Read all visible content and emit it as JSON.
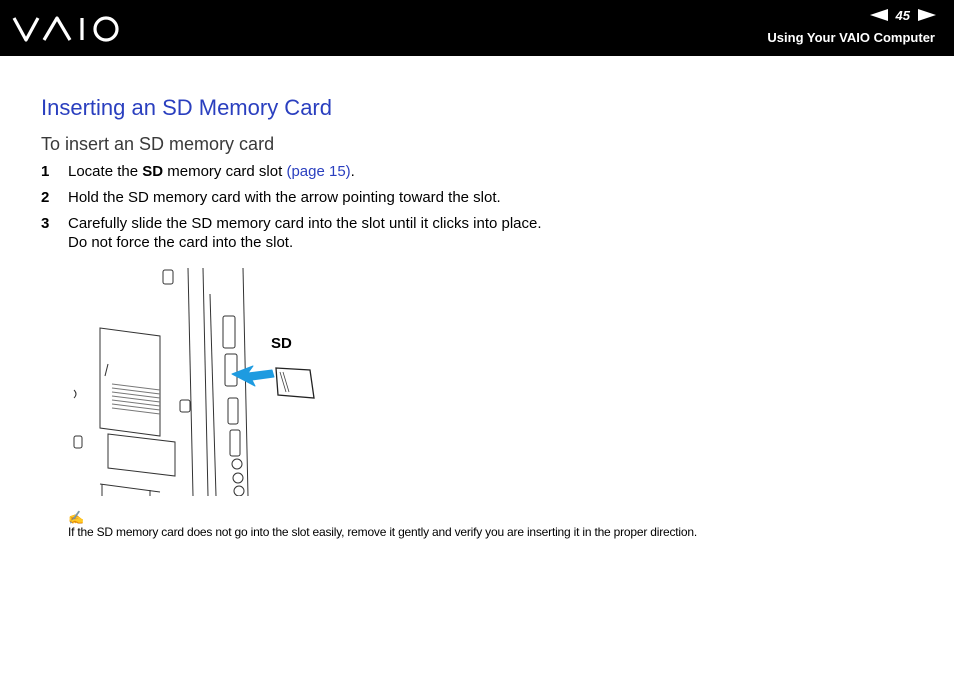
{
  "header": {
    "logo_text": "VAIO",
    "page_number": "45",
    "section_title": "Using Your VAIO Computer"
  },
  "main": {
    "title": "Inserting an SD Memory Card",
    "subtitle": "To insert an SD memory card",
    "steps": [
      {
        "number": "1",
        "pre": "Locate the ",
        "bold": "SD",
        "mid": " memory card slot ",
        "link": "(page 15)",
        "post": "."
      },
      {
        "number": "2",
        "text": "Hold the SD memory card with the arrow pointing toward the slot."
      },
      {
        "number": "3",
        "line1": "Carefully slide the SD memory card into the slot until it clicks into place.",
        "line2": "Do not force the card into the slot."
      }
    ],
    "figure": {
      "label": "SD"
    },
    "note": {
      "icon": "pencil-note-icon",
      "text": "If the SD memory card does not go into the slot easily, remove it gently and verify you are inserting it in the proper direction."
    }
  },
  "colors": {
    "header_bg": "#000000",
    "heading": "#2a3fbf",
    "link": "#2a3fbf",
    "arrow": "#1e9be0"
  }
}
